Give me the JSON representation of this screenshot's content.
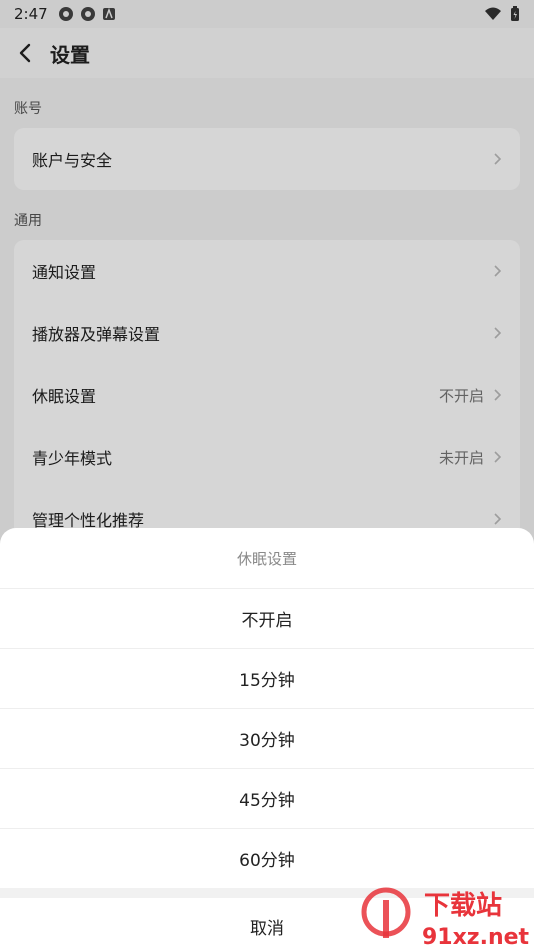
{
  "status": {
    "time": "2:47"
  },
  "header": {
    "title": "设置"
  },
  "sections": [
    {
      "label": "账号",
      "items": [
        {
          "label": "账户与安全",
          "value": ""
        }
      ]
    },
    {
      "label": "通用",
      "items": [
        {
          "label": "通知设置",
          "value": ""
        },
        {
          "label": "播放器及弹幕设置",
          "value": ""
        },
        {
          "label": "休眠设置",
          "value": "不开启"
        },
        {
          "label": "青少年模式",
          "value": "未开启"
        },
        {
          "label": "管理个性化推荐",
          "value": ""
        }
      ]
    }
  ],
  "sheet": {
    "title": "休眠设置",
    "options": [
      "不开启",
      "15分钟",
      "30分钟",
      "45分钟",
      "60分钟"
    ],
    "cancel": "取消"
  },
  "watermark": {
    "text1": "下载站",
    "text2": "91xz.net",
    "color": "#e8343b"
  }
}
